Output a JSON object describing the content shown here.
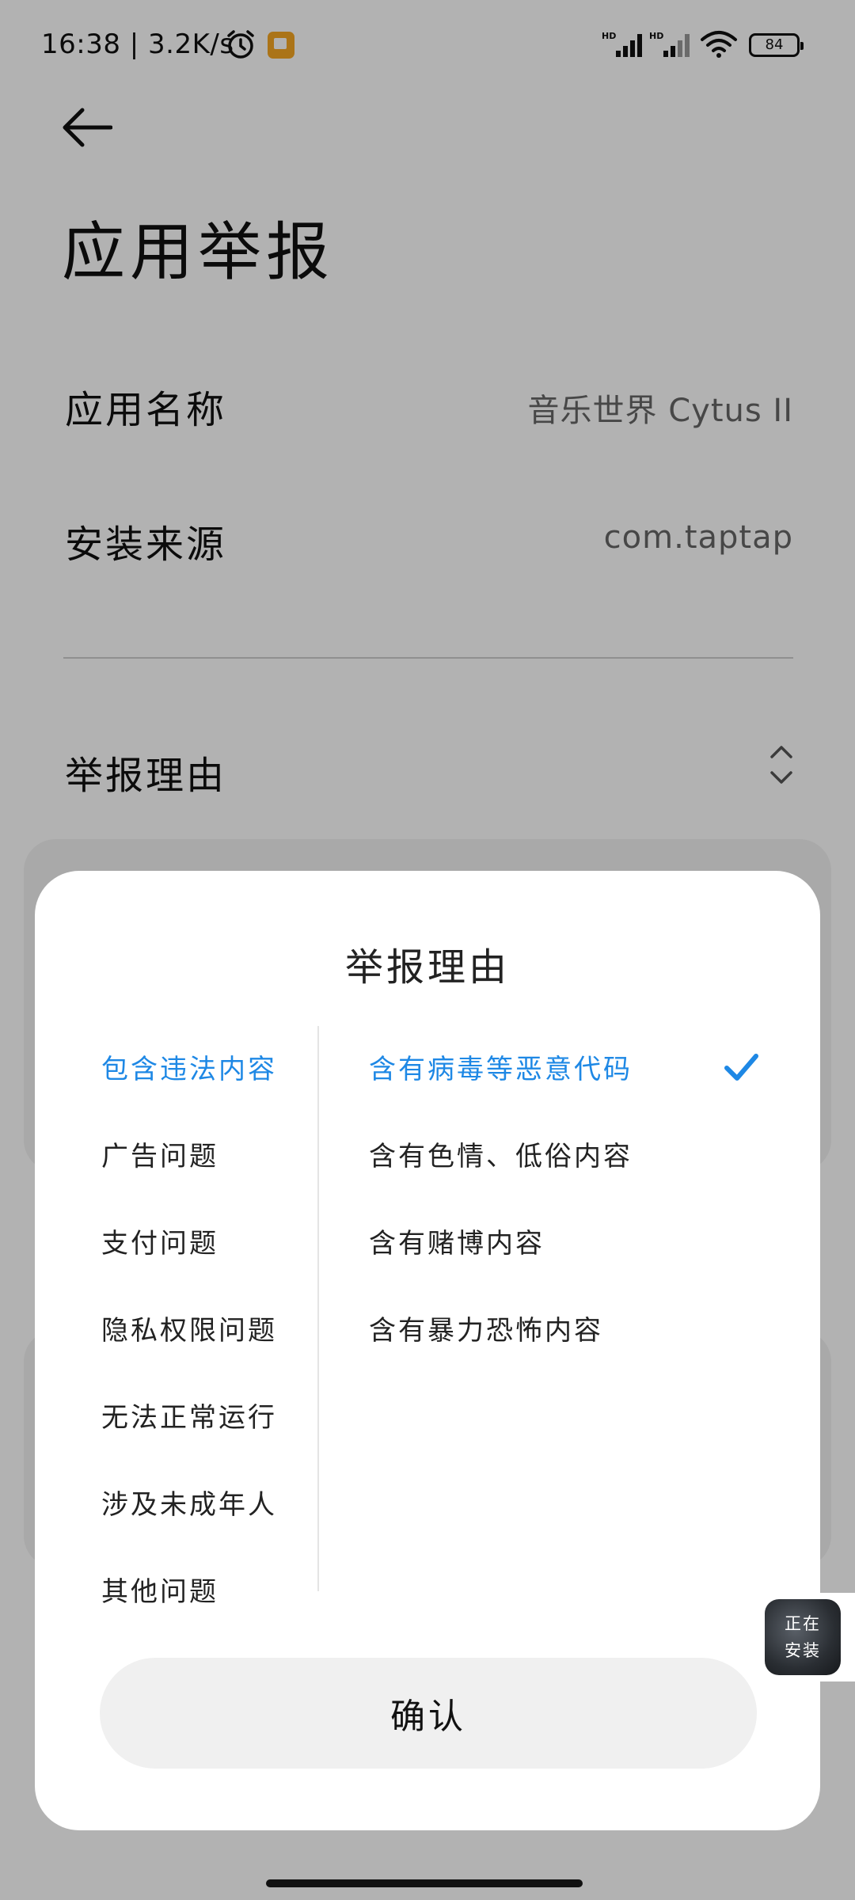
{
  "status_bar": {
    "time": "16:38 | 3.2K/s",
    "battery": "84",
    "icons": [
      "alarm-icon",
      "notification-icon",
      "hd-signal-icon",
      "hd-signal-icon",
      "wifi-icon",
      "battery-icon"
    ]
  },
  "header": {
    "back_icon": "arrow-left-icon",
    "title": "应用举报"
  },
  "info": {
    "app_name_label": "应用名称",
    "app_name_value": "音乐世界 Cytus II",
    "source_label": "安装来源",
    "source_value": "com.taptap"
  },
  "reason_field": {
    "label": "举报理由",
    "icon": "chevron-up-down-icon"
  },
  "dialog": {
    "title": "举报理由",
    "categories": [
      {
        "label": "包含违法内容",
        "selected": true
      },
      {
        "label": "广告问题",
        "selected": false
      },
      {
        "label": "支付问题",
        "selected": false
      },
      {
        "label": "隐私权限问题",
        "selected": false
      },
      {
        "label": "无法正常运行",
        "selected": false
      },
      {
        "label": "涉及未成年人",
        "selected": false
      },
      {
        "label": "其他问题",
        "selected": false
      }
    ],
    "reasons": [
      {
        "label": "含有病毒等恶意代码",
        "selected": true
      },
      {
        "label": "含有色情、低俗内容",
        "selected": false
      },
      {
        "label": "含有赌博内容",
        "selected": false
      },
      {
        "label": "含有暴力恐怖内容",
        "selected": false
      }
    ],
    "confirm_label": "确认"
  },
  "install_widget": {
    "line1": "正在",
    "line2": "安装"
  },
  "colors": {
    "accent": "#1e88e5",
    "scrim": "rgba(0,0,0,0.30)",
    "button_bg": "#f0f0f0"
  }
}
